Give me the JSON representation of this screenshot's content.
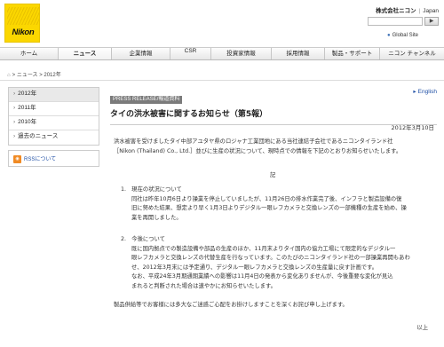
{
  "header": {
    "logo": "Nikon",
    "corp_name": "株式会社ニコン",
    "separator": "|",
    "language": "Japan",
    "search_button": "▶",
    "global_site": "Global Site"
  },
  "nav": {
    "items": [
      {
        "label": "ホーム",
        "active": false
      },
      {
        "label": "ニュース",
        "active": true
      },
      {
        "label": "企業情報",
        "active": false
      },
      {
        "label": "CSR",
        "active": false
      },
      {
        "label": "投資家情報",
        "active": false
      },
      {
        "label": "採用情報",
        "active": false
      },
      {
        "label": "製品・サポート",
        "active": false
      },
      {
        "label": "ニコン チャンネル",
        "active": false
      }
    ]
  },
  "breadcrumb": {
    "sep1": ">",
    "item1": "ニュース",
    "sep2": ">",
    "item2": "2012年"
  },
  "sidebar": {
    "items": [
      {
        "label": "2012年",
        "current": true
      },
      {
        "label": "2011年",
        "current": false
      },
      {
        "label": "2010年",
        "current": false
      },
      {
        "label": "過去のニュース",
        "current": false
      }
    ],
    "rss_label": "RSSについて"
  },
  "article": {
    "badge": "PRESS RELEASE/報道資料",
    "english_link": "English",
    "title": "タイの洪水被害に関するお知らせ（第5報）",
    "date": "2012年3月10日",
    "intro_line1": "洪水被害を受けましたタイ中部アユタヤ県のロジャナ工業団地にある当社連結子会社であるニコンタイランド社",
    "intro_line2": "［Nikon (Thailand) Co., Ltd.］並びに生産の状況について、現時点での情報を下記のとおりお知らせいたします。",
    "ki": "記",
    "section1": {
      "heading": "1.　現在の状況について",
      "lines": [
        "同社は昨年10月6日より操業を停止していましたが、11月26日の排水作業完了後、インフラと製造設備の復",
        "旧に努めた結果、想定より早く1月3日よりデジタル一眼レフカメラと交換レンズの一部機種の生産を始め、操",
        "業を再開しました。"
      ]
    },
    "section2": {
      "heading": "2.　今後について",
      "lines": [
        "既に国内拠点での製造設備や部品の生産のほか、11月末よりタイ国内の協力工場にて限定的なデジタル一",
        "眼レフカメラと交換レンズの代替生産を行なっています。このたびのニコンタイランド社の一部操業再開もあわ",
        "せ、2012年3月末には予定通り、デジタル一眼レフカメラと交換レンズの生産量に戻す計画です。",
        "なお、平成24年3月期通期業績への影響は11月4日の発表から変化ありませんが、今後重要な変化が見込",
        "まれると判断された場合は速やかにお知らせいたします。"
      ]
    },
    "closing": "製品供給等でお客様には多大なご迷惑ご心配をお掛けしますことを深くお詫び申し上げます。",
    "end": "以上"
  }
}
